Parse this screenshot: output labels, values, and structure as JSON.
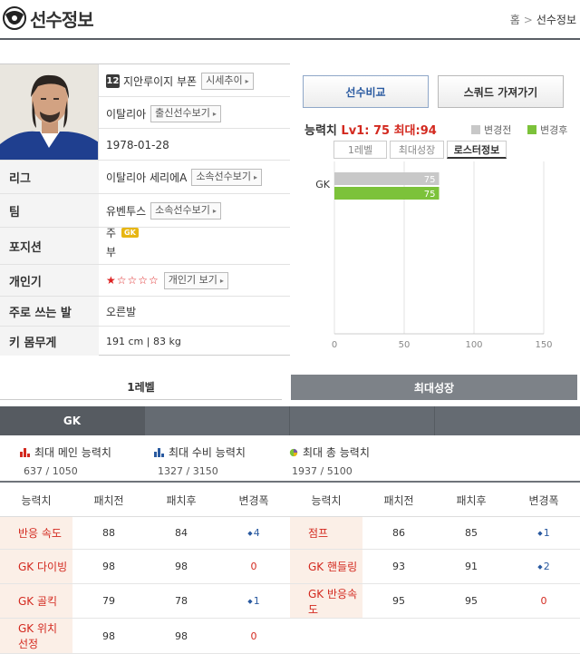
{
  "header": {
    "title": "선수정보",
    "breadcrumb": [
      "홈",
      "선수정보"
    ]
  },
  "player": {
    "number": "12",
    "name": "지안루이지 부폰",
    "price_trend_btn": "시세추이",
    "nation": "이탈리아",
    "nation_btn": "출신선수보기",
    "birth": "1978-01-28",
    "league_label": "리그",
    "league": "이탈리아 세리에A",
    "league_btn": "소속선수보기",
    "team_label": "팀",
    "team": "유벤투스",
    "team_btn": "소속선수보기",
    "position_label": "포지션",
    "position_main": "주",
    "position_badge": "GK",
    "position_sub": "부",
    "skill_label": "개인기",
    "skill_stars": "★☆☆☆☆",
    "skill_btn": "개인기 보기",
    "foot_label": "주로 쓰는 발",
    "foot": "오른발",
    "body_label": "키 몸무게",
    "body": "191 cm  |  83 kg"
  },
  "actions": {
    "compare": "선수비교",
    "squad": "스쿼드 가져가기"
  },
  "ability": {
    "label": "능력치",
    "lv1": "Lv1: 75",
    "max": "최대:94",
    "legend_before": "변경전",
    "legend_after": "변경후",
    "tabs": [
      "1레벨",
      "최대성장",
      "로스터정보"
    ]
  },
  "chart_data": {
    "type": "bar",
    "orientation": "horizontal",
    "categories": [
      "GK"
    ],
    "series": [
      {
        "name": "변경전",
        "values": [
          75
        ],
        "color": "#c8c8c8"
      },
      {
        "name": "변경후",
        "values": [
          75
        ],
        "color": "#7cc23a"
      }
    ],
    "xlim": [
      0,
      150
    ],
    "xticks": [
      "0",
      "50",
      "100",
      "150"
    ],
    "grid": true
  },
  "level_tabs": {
    "lvl1": "1레벨",
    "max": "최대성장"
  },
  "position_tab": "GK",
  "summary": [
    {
      "title": "최대 메인 능력치",
      "value": "637 / 1050",
      "icon": "bar-chart-red-icon"
    },
    {
      "title": "최대 수비 능력치",
      "value": "1327 / 3150",
      "icon": "bar-chart-blue-icon"
    },
    {
      "title": "최대 총 능력치",
      "value": "1937 / 5100",
      "icon": "pie-chart-icon"
    }
  ],
  "table": {
    "headers": [
      "능력치",
      "패치전",
      "패치후",
      "변경폭",
      "능력치",
      "패치전",
      "패치후",
      "변경폭"
    ],
    "rows": [
      {
        "l_name": "반응 속도",
        "l_before": "88",
        "l_after": "84",
        "l_change": "4",
        "l_dir": "pos",
        "r_name": "점프",
        "r_before": "86",
        "r_after": "85",
        "r_change": "1",
        "r_dir": "pos"
      },
      {
        "l_name": "GK 다이빙",
        "l_before": "98",
        "l_after": "98",
        "l_change": "0",
        "l_dir": "zero",
        "r_name": "GK 핸들링",
        "r_before": "93",
        "r_after": "91",
        "r_change": "2",
        "r_dir": "pos"
      },
      {
        "l_name": "GK 골킥",
        "l_before": "79",
        "l_after": "78",
        "l_change": "1",
        "l_dir": "pos",
        "r_name": "GK 반응속도",
        "r_before": "95",
        "r_after": "95",
        "r_change": "0",
        "r_dir": "zero"
      },
      {
        "l_name": "GK 위치 선정",
        "l_before": "98",
        "l_after": "98",
        "l_change": "0",
        "l_dir": "zero",
        "r_name": "",
        "r_before": "",
        "r_after": "",
        "r_change": "",
        "r_dir": ""
      }
    ]
  }
}
